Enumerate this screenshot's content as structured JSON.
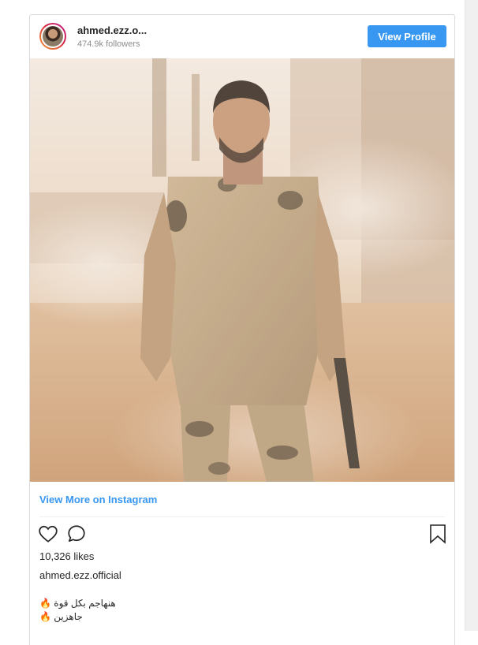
{
  "header": {
    "username": "ahmed.ezz.o...",
    "followers": "474.9k followers",
    "view_profile_label": "View Profile"
  },
  "photo": {
    "description_icon": "post-photo"
  },
  "footer": {
    "view_more_label": "View More on Instagram",
    "likes": "10,326 likes",
    "owner": "ahmed.ezz.official",
    "caption_lines": [
      "هنهاجم بكل قوة 🔥",
      "جاهزين 🔥"
    ]
  },
  "icons": {
    "heart": "heart-icon",
    "comment": "comment-icon",
    "bookmark": "bookmark-icon"
  },
  "colors": {
    "accent": "#3897f0",
    "text": "#262626",
    "muted": "#8e8e8e",
    "border": "#dbdbdb"
  }
}
